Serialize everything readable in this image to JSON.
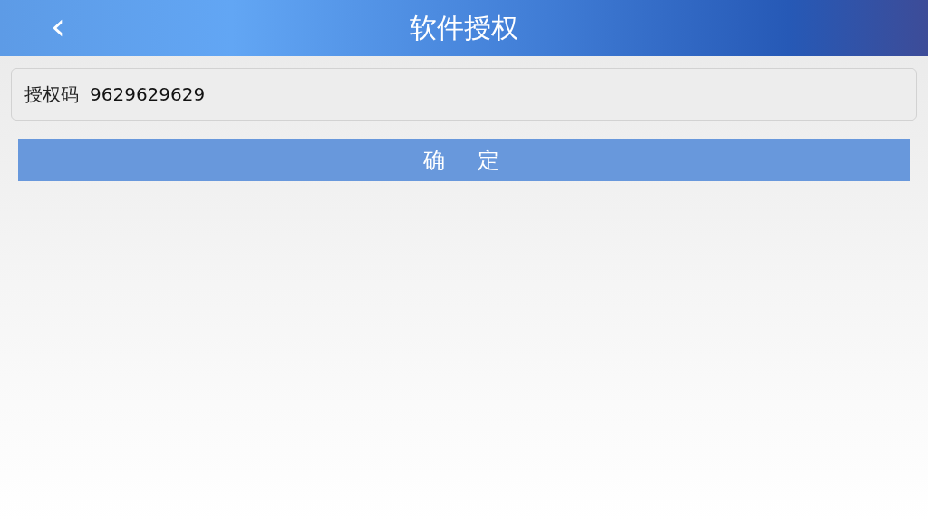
{
  "header": {
    "back_icon": "‹",
    "title": "软件授权"
  },
  "form": {
    "label": "授权码",
    "value": "9629629629"
  },
  "confirm_button": "确　定"
}
